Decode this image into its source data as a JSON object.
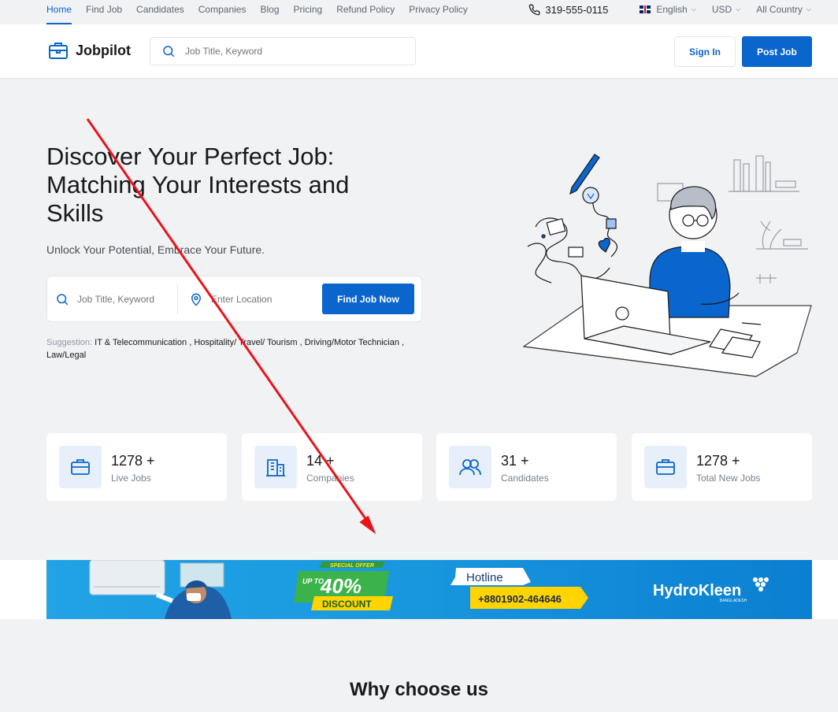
{
  "topbar": {
    "nav": [
      "Home",
      "Find Job",
      "Candidates",
      "Companies",
      "Blog",
      "Pricing",
      "Refund Policy",
      "Privacy Policy"
    ],
    "phone": "319-555-0115",
    "language": "English",
    "currency": "USD",
    "country": "All Country"
  },
  "header": {
    "logo": "Jobpilot",
    "search_placeholder": "Job Title, Keyword",
    "sign_in": "Sign In",
    "post_job": "Post Job"
  },
  "hero": {
    "title": "Discover Your Perfect Job: Matching Your Interests and Skills",
    "subtitle": "Unlock Your Potential, Embrace Your Future.",
    "keyword_placeholder": "Job Title, Keyword",
    "location_placeholder": "Enter Location",
    "find_button": "Find Job Now",
    "suggestion_label": "Suggestion:",
    "suggestions": [
      "IT & Telecommunication",
      "Hospitality/ Travel/ Tourism",
      "Driving/Motor Technician",
      "Law/Legal"
    ]
  },
  "stats": [
    {
      "value": "1278 +",
      "label": "Live Jobs",
      "icon": "briefcase-icon"
    },
    {
      "value": "14 +",
      "label": "Companies",
      "icon": "building-icon"
    },
    {
      "value": "31 +",
      "label": "Candidates",
      "icon": "users-icon"
    },
    {
      "value": "1278 +",
      "label": "Total New Jobs",
      "icon": "briefcase-icon"
    }
  ],
  "banner": {
    "special_offer": "SPECIAL OFFER",
    "up_to": "UP TO",
    "percent": "40%",
    "discount": "DISCOUNT",
    "hotline_label": "Hotline",
    "hotline_number": "+8801902-464646",
    "brand": "HydroKleen",
    "brand_sub": "BANGLADESH"
  },
  "section_title": "Why choose us",
  "colors": {
    "accent": "#0a65cc",
    "annotation": "#e8141b"
  }
}
